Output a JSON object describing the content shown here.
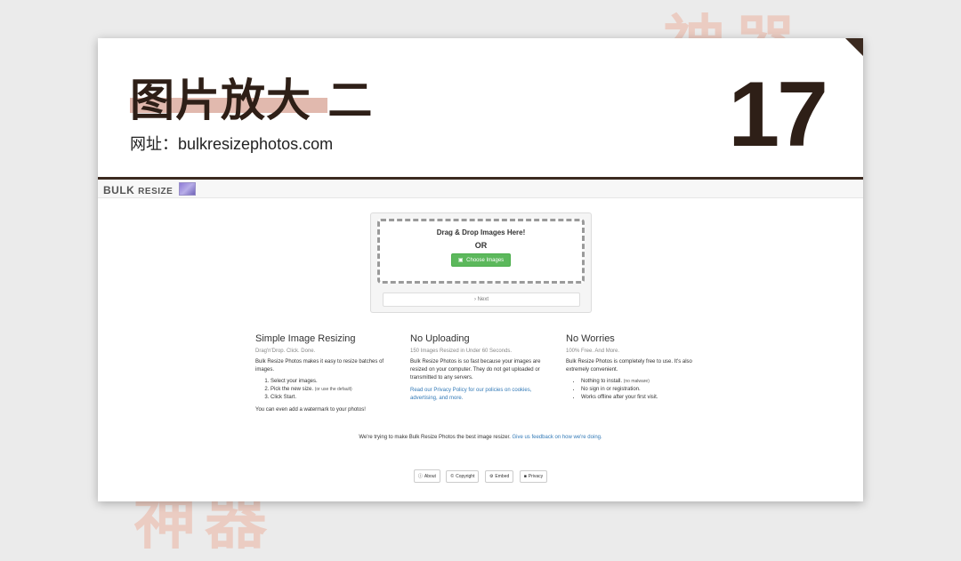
{
  "slide": {
    "title": "图片放大 二",
    "subtitle": "网址：bulkresizephotos.com",
    "number": "17",
    "bg_text_top": "神器",
    "bg_text_bottom": "神器"
  },
  "site": {
    "logo_text": "BULK",
    "logo_text_alt": "RESIZE",
    "upload": {
      "drop_text": "Drag & Drop Images Here!",
      "or_text": "OR",
      "choose_button": "Choose Images",
      "next_button": "Next"
    },
    "columns": [
      {
        "heading": "Simple Image Resizing",
        "subheading": "Drag'n'Drop. Click. Done.",
        "text": "Bulk Resize Photos makes it easy to resize batches of images.",
        "steps": [
          "Select your images.",
          "Pick the new size.",
          "Click Start."
        ],
        "step_note": "(or use the default)",
        "footer_text": "You can even add a watermark to your photos!"
      },
      {
        "heading": "No Uploading",
        "subheading": "150 Images Resized in Under 60 Seconds.",
        "text": "Bulk Resize Photos is so fast because your images are resized on your computer. They do not get uploaded or transmitted to any servers.",
        "link_text": "Read our Privacy Policy for our policies on cookies, advertising, and more."
      },
      {
        "heading": "No Worries",
        "subheading": "100% Free. And More.",
        "text": "Bulk Resize Photos is completely free to use. It's also extremely convenient.",
        "bullets": [
          "Nothing to install.",
          "No sign in or registration.",
          "Works offline after your first visit."
        ],
        "bullet_note": "(no malware)"
      }
    ],
    "feedback_text": "We're trying to make Bulk Resize Photos the best image resizer.",
    "feedback_link": "Give us feedback on how we're doing.",
    "footer_buttons": [
      "About",
      "Copyright",
      "Embed",
      "Privacy"
    ]
  },
  "colors": {
    "accent_dark": "#3b2a20",
    "highlight": "#e1b9ae",
    "green_button": "#5cb85c",
    "link": "#337ab7"
  },
  "icons": [
    "image-icon",
    "chevron-right-icon",
    "info-icon",
    "copyright-icon",
    "gear-icon",
    "lock-icon"
  ]
}
